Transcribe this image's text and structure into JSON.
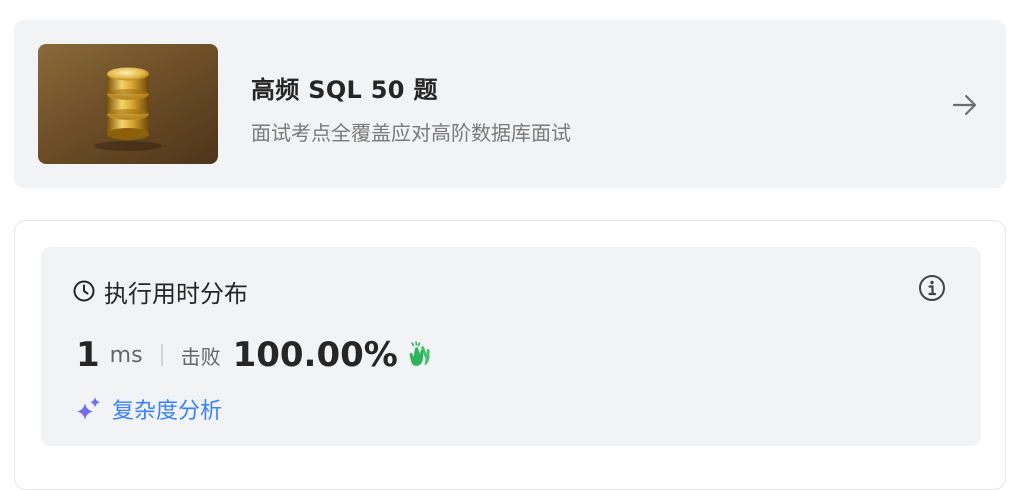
{
  "study_plan": {
    "title": "高频 SQL 50 题",
    "subtitle": "面试考点全覆盖应对高阶数据库面试",
    "cover_icon": "database-icon",
    "arrow_icon": "arrow-right-icon"
  },
  "runtime": {
    "title": "执行用时分布",
    "value": "1",
    "unit": "ms",
    "beat_label": "击败",
    "beat_value": "100.00%",
    "complexity_label": "复杂度分析",
    "colors": {
      "clap": "#2db55d",
      "complexity_link": "#3b82f6",
      "sparkle_start": "#a855f7",
      "sparkle_end": "#3b82f6"
    }
  }
}
